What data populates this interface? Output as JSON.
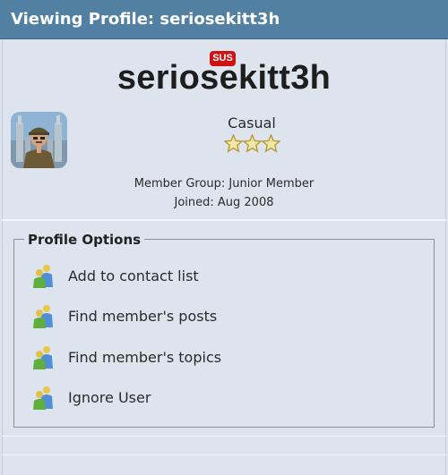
{
  "header": {
    "title": "Viewing Profile: seriosekitt3h"
  },
  "profile": {
    "badge": "SUS",
    "username": "seriosekitt3h",
    "rank_title": "Casual",
    "rating_stars": 3,
    "member_group": "Member Group: Junior Member",
    "joined": "Joined: Aug 2008"
  },
  "options": {
    "legend": "Profile Options",
    "items": [
      {
        "label": "Add to contact list",
        "icon": "users-icon"
      },
      {
        "label": "Find member's posts",
        "icon": "users-icon"
      },
      {
        "label": "Find member's topics",
        "icon": "users-icon"
      },
      {
        "label": "Ignore User",
        "icon": "users-icon"
      }
    ]
  },
  "colors": {
    "header_bg": "#5280a2",
    "page_bg": "#dde4ee",
    "badge_bg": "#d01012",
    "star_fill": "#f3e7a6"
  }
}
